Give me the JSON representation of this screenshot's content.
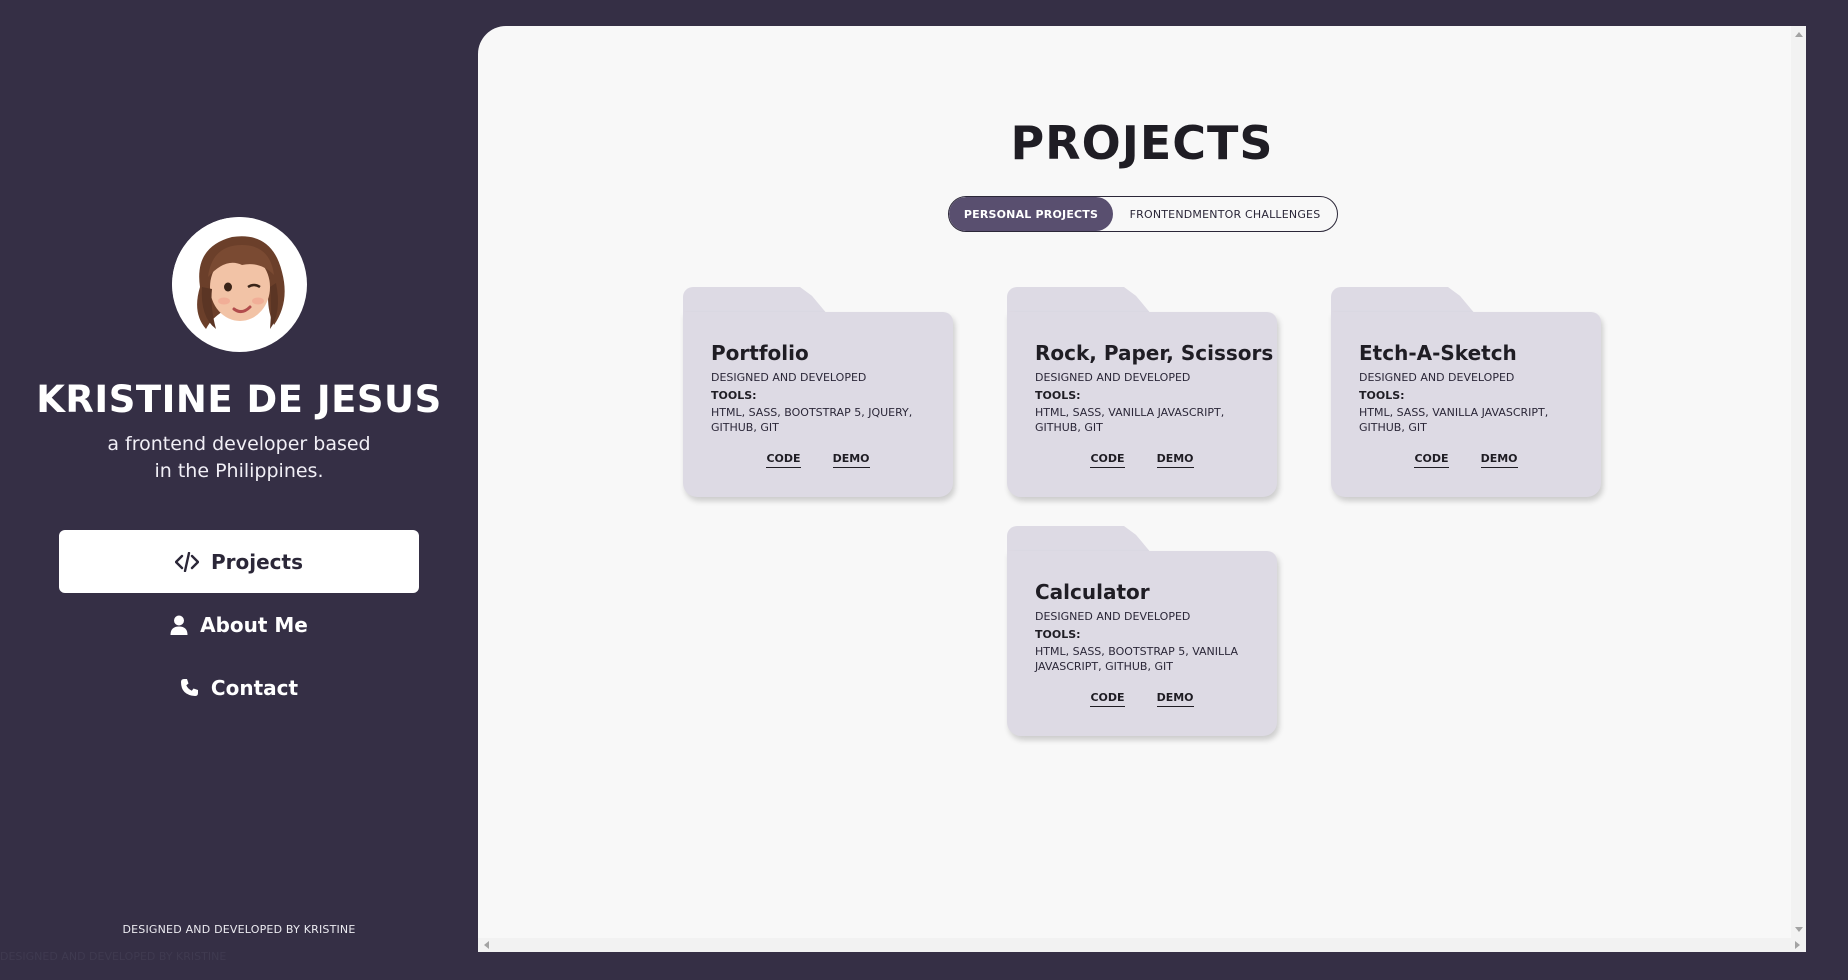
{
  "sidebar": {
    "name": "KRISTINE DE JESUS",
    "tagline": "a frontend developer based in the Philippines.",
    "nav": [
      {
        "label": "Projects",
        "icon": "code-icon",
        "active": true
      },
      {
        "label": "About Me",
        "icon": "user-icon",
        "active": false
      },
      {
        "label": "Contact",
        "icon": "phone-icon",
        "active": false
      }
    ],
    "footer": "DESIGNED AND DEVELOPED BY KRISTINE",
    "ghost_footer": "DESIGNED AND DEVELOPED BY KRISTINE"
  },
  "main": {
    "title": "PROJECTS",
    "tabs": [
      {
        "label": "PERSONAL PROJECTS",
        "active": true
      },
      {
        "label": "FRONTENDMENTOR CHALLENGES",
        "active": false
      }
    ],
    "projects": [
      {
        "title": "Portfolio",
        "subtitle": "DESIGNED AND DEVELOPED",
        "tools_label": "TOOLS:",
        "tools": "HTML, SASS, BOOTSTRAP 5, JQUERY, GITHUB, GIT",
        "code_label": "CODE",
        "demo_label": "DEMO"
      },
      {
        "title": "Rock, Paper, Scissors",
        "subtitle": "DESIGNED AND DEVELOPED",
        "tools_label": "TOOLS:",
        "tools": "HTML, SASS, VANILLA JAVASCRIPT, GITHUB, GIT",
        "code_label": "CODE",
        "demo_label": "DEMO"
      },
      {
        "title": "Etch-A-Sketch",
        "subtitle": "DESIGNED AND DEVELOPED",
        "tools_label": "TOOLS:",
        "tools": "HTML, SASS, VANILLA JAVASCRIPT, GITHUB, GIT",
        "code_label": "CODE",
        "demo_label": "DEMO"
      },
      {
        "title": "Calculator",
        "subtitle": "DESIGNED AND DEVELOPED",
        "tools_label": "TOOLS:",
        "tools": "HTML, SASS, BOOTSTRAP 5, VANILLA JAVASCRIPT, GITHUB, GIT",
        "code_label": "CODE",
        "demo_label": "DEMO"
      }
    ]
  },
  "colors": {
    "background": "#352f45",
    "panel": "#f8f8f8",
    "card": "#dddae4",
    "accent": "#594f6f",
    "text_dark": "#1f1d24"
  }
}
